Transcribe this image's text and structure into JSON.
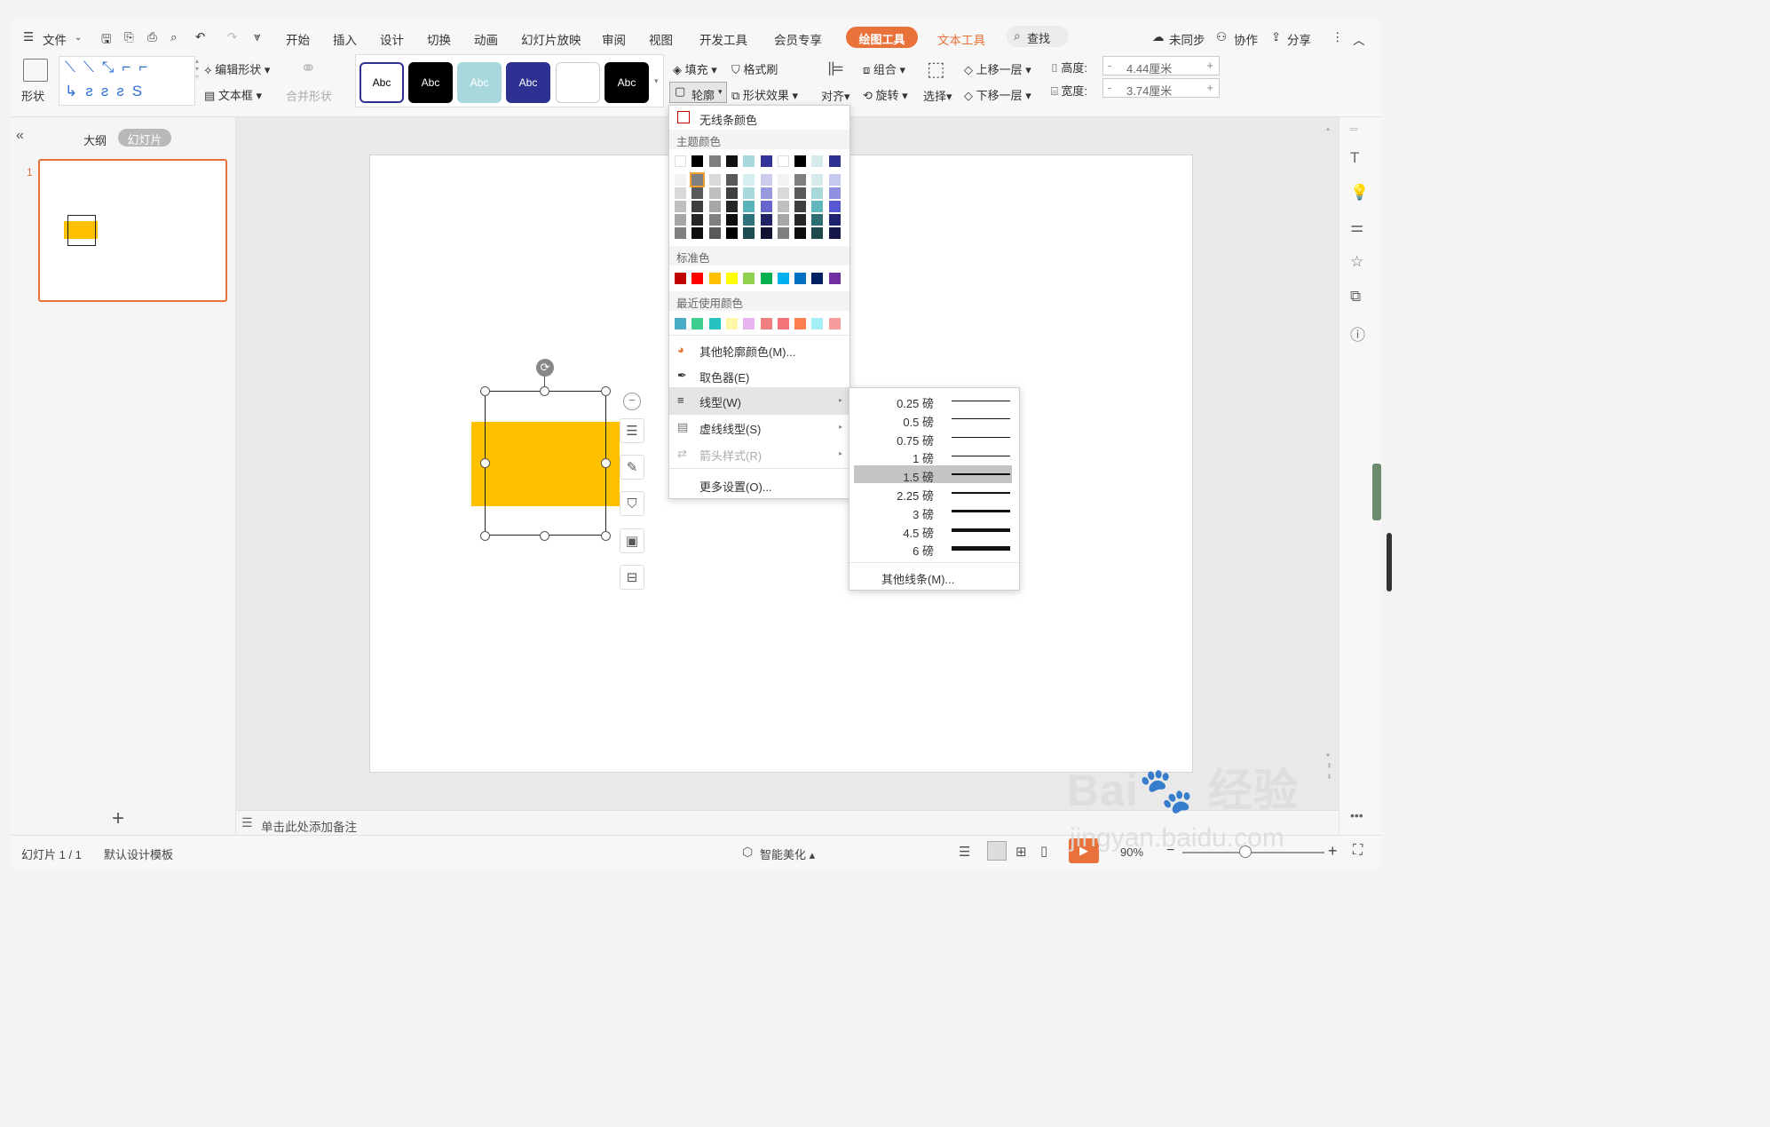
{
  "menubar": {
    "file": "文件",
    "tabs": [
      "开始",
      "插入",
      "设计",
      "切换",
      "动画",
      "幻灯片放映",
      "审阅",
      "视图",
      "开发工具",
      "会员专享"
    ],
    "active_tab": "绘图工具",
    "text_tool_tab": "文本工具",
    "search": "查找",
    "sync": "未同步",
    "collab": "协作",
    "share": "分享"
  },
  "ribbon": {
    "shape": "形状",
    "edit_shape": "编辑形状",
    "textbox": "文本框",
    "merge_shape": "合并形状",
    "styles": [
      "Abc",
      "Abc",
      "Abc",
      "Abc",
      "",
      "Abc"
    ],
    "fill": "填充",
    "format_painter": "格式刷",
    "outline": "轮廓",
    "shape_effect": "形状效果",
    "align": "对齐",
    "group": "组合",
    "rotate": "旋转",
    "select": "选择",
    "bring_forward": "上移一层",
    "send_backward": "下移一层",
    "height_label": "高度:",
    "height_value": "4.44厘米",
    "width_label": "宽度:",
    "width_value": "3.74厘米"
  },
  "leftpanel": {
    "outline_tab": "大纲",
    "slides_tab": "幻灯片",
    "slide_number": "1"
  },
  "outline_menu": {
    "no_line": "无线条颜色",
    "theme_colors": "主题颜色",
    "standard_colors": "标准色",
    "recent_colors": "最近使用颜色",
    "more_colors": "其他轮廓颜色(M)...",
    "eyedropper": "取色器(E)",
    "line_type": "线型(W)",
    "dash_type": "虚线线型(S)",
    "arrow_style": "箭头样式(R)",
    "more_settings": "更多设置(O)...",
    "theme_top": [
      "#ffffff",
      "#000000",
      "#7f7f7f",
      "#111111",
      "#a8d8dc",
      "#333399",
      "#ffffff",
      "#000000",
      "#d5ebec",
      "#2e3192"
    ],
    "standard": [
      "#c00000",
      "#ff0000",
      "#ffc000",
      "#ffff00",
      "#92d050",
      "#00b050",
      "#00b0f0",
      "#0070c0",
      "#002060",
      "#7030a0"
    ],
    "recent": [
      "#4bacc6",
      "#3ecf8e",
      "#25c2c2",
      "#fff6a8",
      "#e8b3f0",
      "#f08080",
      "#f4727a",
      "#ff7f50",
      "#a6eef8",
      "#f79c9c"
    ]
  },
  "line_menu": {
    "widths": [
      "0.25 磅",
      "0.5 磅",
      "0.75 磅",
      "1 磅",
      "1.5 磅",
      "2.25 磅",
      "3 磅",
      "4.5 磅",
      "6 磅"
    ],
    "selected": "1.5 磅",
    "more_lines": "其他线条(M)..."
  },
  "notes": {
    "placeholder": "单击此处添加备注"
  },
  "status": {
    "slide_count": "幻灯片 1 / 1",
    "template": "默认设计模板",
    "beautify": "智能美化",
    "zoom": "90%"
  },
  "watermark": {
    "text": "jingyan.baidu.com"
  }
}
